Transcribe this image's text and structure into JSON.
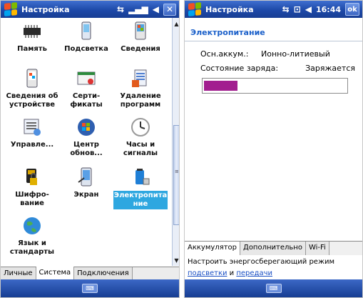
{
  "left": {
    "title": "Настройка",
    "icons": [
      {
        "label": "Память",
        "icon": "memory-chip-icon"
      },
      {
        "label": "Подсветка",
        "icon": "backlight-phone-icon"
      },
      {
        "label": "Сведения",
        "icon": "info-icon"
      },
      {
        "label": "Сведения об\nустройстве",
        "icon": "device-info-icon"
      },
      {
        "label": "Серти-\nфикаты",
        "icon": "certificate-icon"
      },
      {
        "label": "Удаление\nпрограмм",
        "icon": "remove-programs-icon"
      },
      {
        "label": "Управле...",
        "icon": "manage-icon"
      },
      {
        "label": "Центр\nобнов...",
        "icon": "update-center-icon"
      },
      {
        "label": "Часы и\nсигналы",
        "icon": "clock-icon"
      },
      {
        "label": "Шифро-\nвание",
        "icon": "encryption-icon"
      },
      {
        "label": "Экран",
        "icon": "screen-icon"
      },
      {
        "label": "Электропита\nние",
        "icon": "power-icon"
      },
      {
        "label": "Язык и\nстандарты",
        "icon": "globe-icon"
      }
    ],
    "selected_index": 11,
    "tabs": [
      "Личные",
      "Система",
      "Подключения"
    ],
    "active_tab": 1
  },
  "right": {
    "title": "Настройка",
    "clock": "16:44",
    "ok_label": "ok",
    "section_title": "Электропитание",
    "battery_type_label": "Осн.аккум.:",
    "battery_type_value": "Ионно-литиевый",
    "charge_state_label": "Состояние заряда:",
    "charge_state_value": "Заряжается",
    "charge_level": 0.24,
    "charge_color": "#a21e8f",
    "tabs": [
      "Аккумулятор",
      "Дополнительно",
      "Wi-Fi"
    ],
    "active_tab": 0,
    "footer_text": "Настроить энергосберегающий режим",
    "footer_link1": "подсветки",
    "footer_and": " и ",
    "footer_link2": "передачи"
  },
  "colors": {
    "titlebar": "#1d49a8",
    "selection": "#2ea7e0",
    "link": "#1a4fc4"
  }
}
